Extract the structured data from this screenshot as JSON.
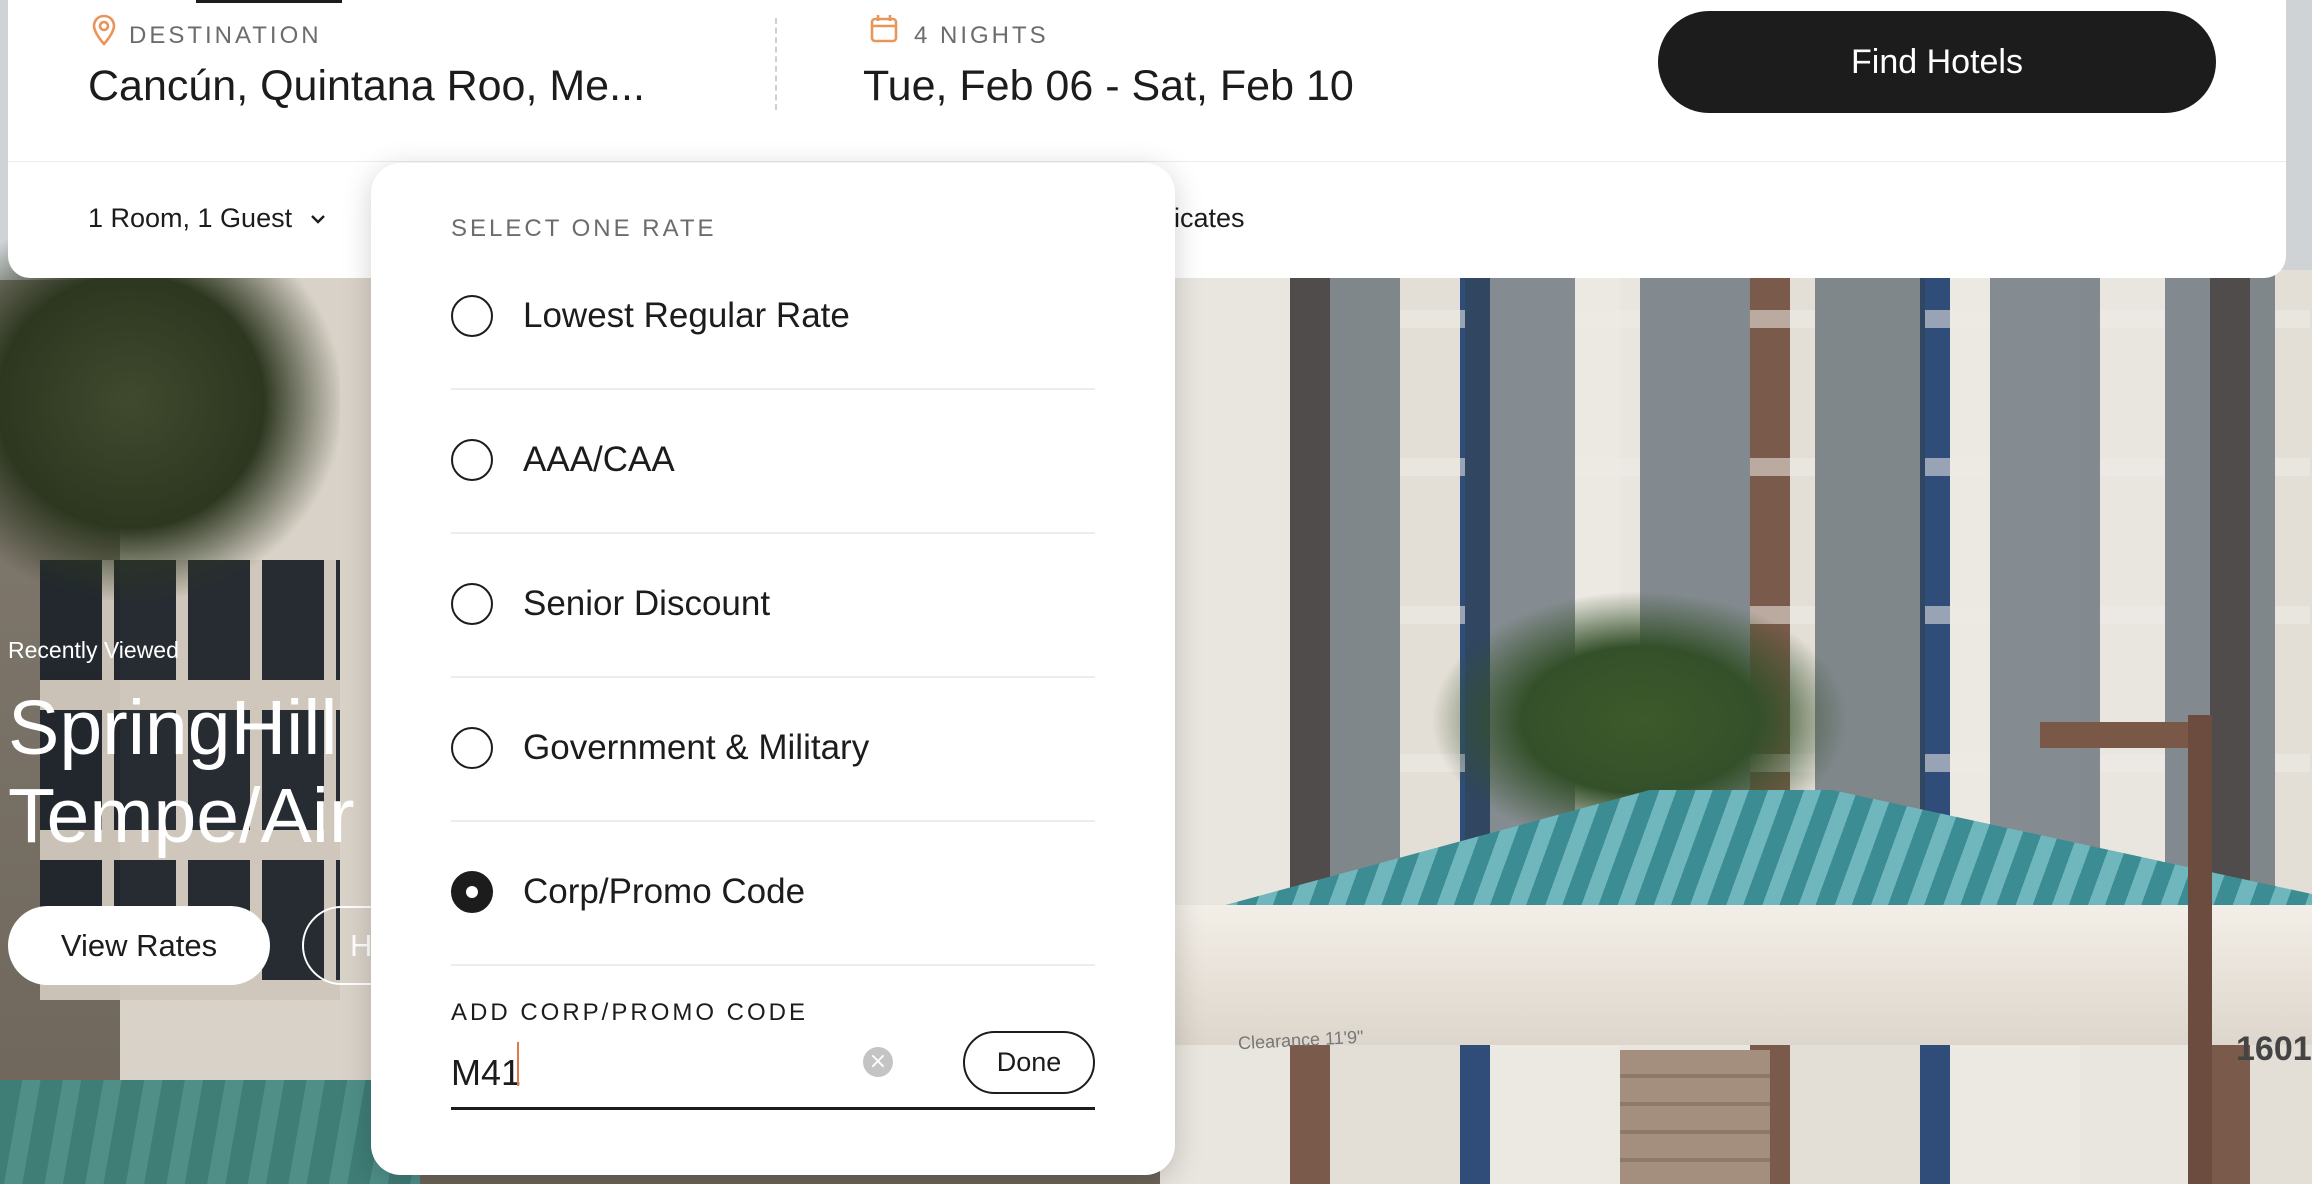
{
  "search": {
    "destination_label": "DESTINATION",
    "destination_value": "Cancún, Quintana Roo, Me...",
    "nights_label": "4 NIGHTS",
    "dates_value": "Tue, Feb 06 - Sat, Feb 10",
    "find_button": "Find Hotels",
    "rooms_guests": "1 Room, 1 Guest",
    "certificates_partial": "rtificates"
  },
  "rate_panel": {
    "heading": "SELECT ONE RATE",
    "options": [
      {
        "label": "Lowest Regular Rate",
        "selected": false
      },
      {
        "label": "AAA/CAA",
        "selected": false
      },
      {
        "label": "Senior Discount",
        "selected": false
      },
      {
        "label": "Government & Military",
        "selected": false
      },
      {
        "label": "Corp/Promo Code",
        "selected": true
      }
    ],
    "promo_heading": "ADD CORP/PROMO CODE",
    "promo_value": "M41",
    "done_button": "Done"
  },
  "hero": {
    "recently_viewed": "Recently Viewed",
    "title_line1": "SpringHill",
    "title_line2": "Tempe/Air",
    "view_rates_button": "View Rates",
    "secondary_button_partial": "H",
    "canopy_sign": "Clearance 11'9\"",
    "building_number": "1601"
  },
  "colors": {
    "accent_orange": "#e8955a",
    "primary_dark": "#1c1c1c",
    "caret": "#e0784a"
  },
  "icons": {
    "destination": "map-pin-icon",
    "dates": "calendar-icon",
    "rooms_dropdown": "chevron-down-icon",
    "clear_input": "clear-circle-icon"
  }
}
